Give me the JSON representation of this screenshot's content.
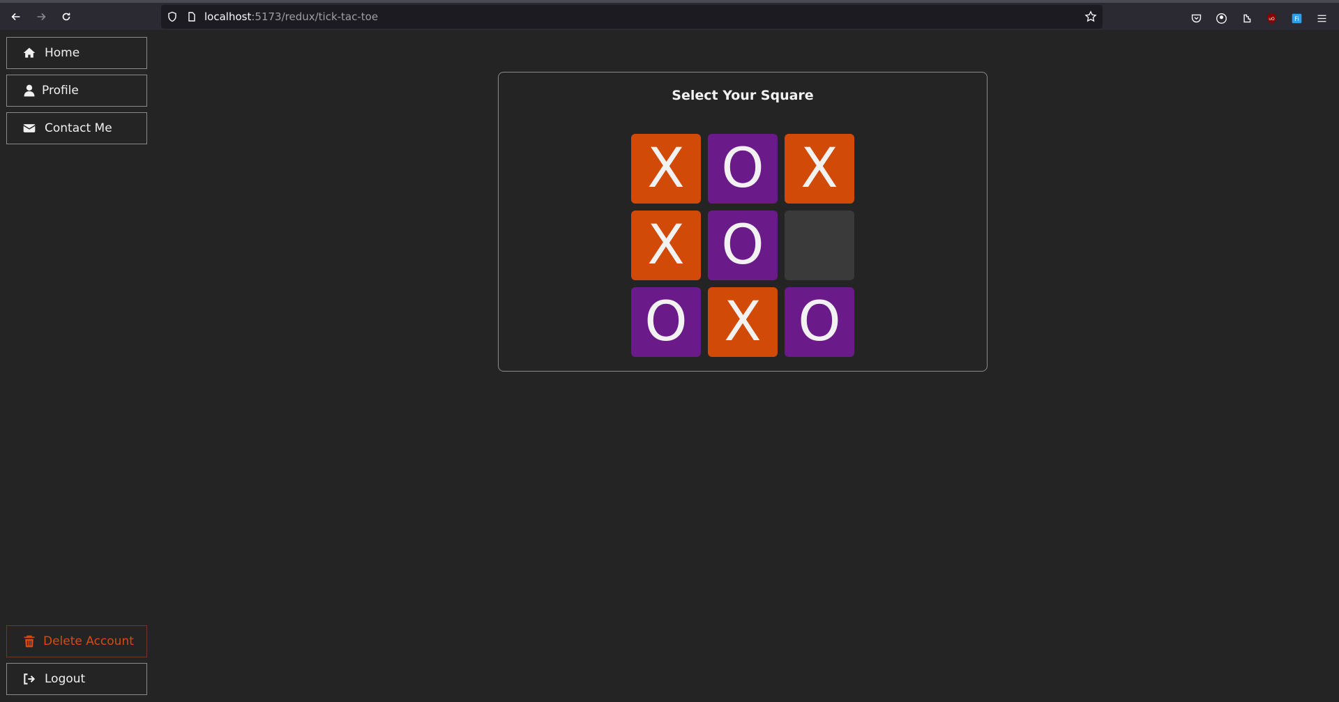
{
  "browser": {
    "url_host": "localhost",
    "url_rest": ":5173/redux/tick-tac-toe"
  },
  "sidebar": {
    "top_items": [
      {
        "label": "Home",
        "icon": "home-icon"
      },
      {
        "label": "Profile",
        "icon": "user-icon"
      },
      {
        "label": "Contact Me",
        "icon": "envelope-icon"
      }
    ],
    "bottom_items": [
      {
        "label": "Delete Account",
        "icon": "trash-icon"
      },
      {
        "label": "Logout",
        "icon": "logout-icon"
      }
    ]
  },
  "game": {
    "title": "Select Your Square",
    "board": [
      "X",
      "O",
      "X",
      "X",
      "O",
      "",
      "O",
      "X",
      "O"
    ]
  },
  "colors": {
    "x_square": "#d14a07",
    "o_square": "#6b1a8a",
    "empty_square": "#3a3a3a",
    "danger": "#d84a14"
  }
}
